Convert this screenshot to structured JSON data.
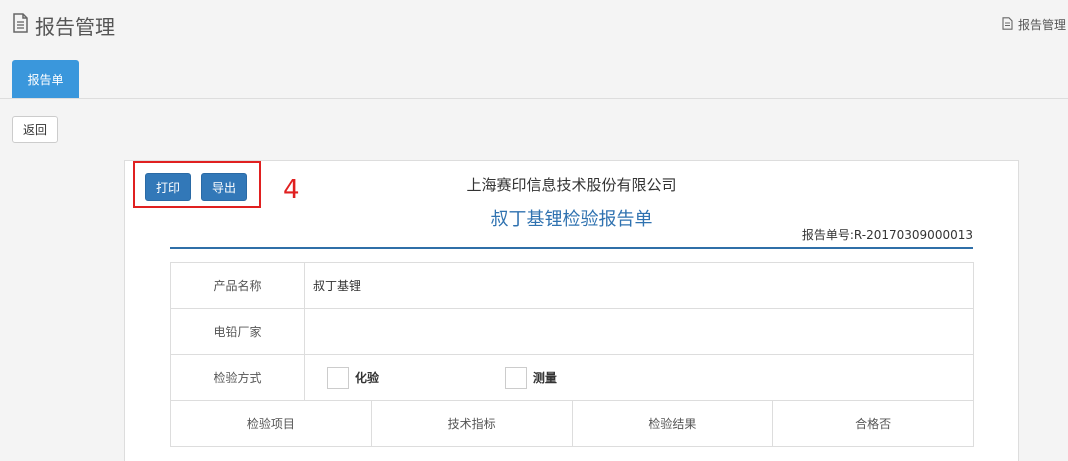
{
  "page": {
    "title": "报告管理",
    "title_icon": "document-icon",
    "crumb": "报告管理",
    "crumb_icon": "document-icon"
  },
  "tabs": [
    {
      "label": "报告单",
      "active": true
    }
  ],
  "toolbar": {
    "back_label": "返回"
  },
  "report": {
    "print_label": "打印",
    "export_label": "导出",
    "step_marker": "4",
    "company": "上海赛印信息技术股份有限公司",
    "title": "叔丁基锂检验报告单",
    "report_no": "报告单号:R-20170309000013",
    "fields": {
      "product_name_label": "产品名称",
      "product_name_value": "叔丁基锂",
      "manufacturer_label": "电铅厂家",
      "manufacturer_value": "",
      "method_label": "检验方式",
      "method_options": [
        "化验",
        "测量"
      ]
    },
    "items_headers": [
      "检验项目",
      "技术指标",
      "检验结果",
      "合格否"
    ]
  },
  "colors": {
    "accent": "#3a97dc",
    "button_blue": "#3278b8",
    "title_blue": "#2f72b0",
    "highlight_red": "#e02020"
  }
}
